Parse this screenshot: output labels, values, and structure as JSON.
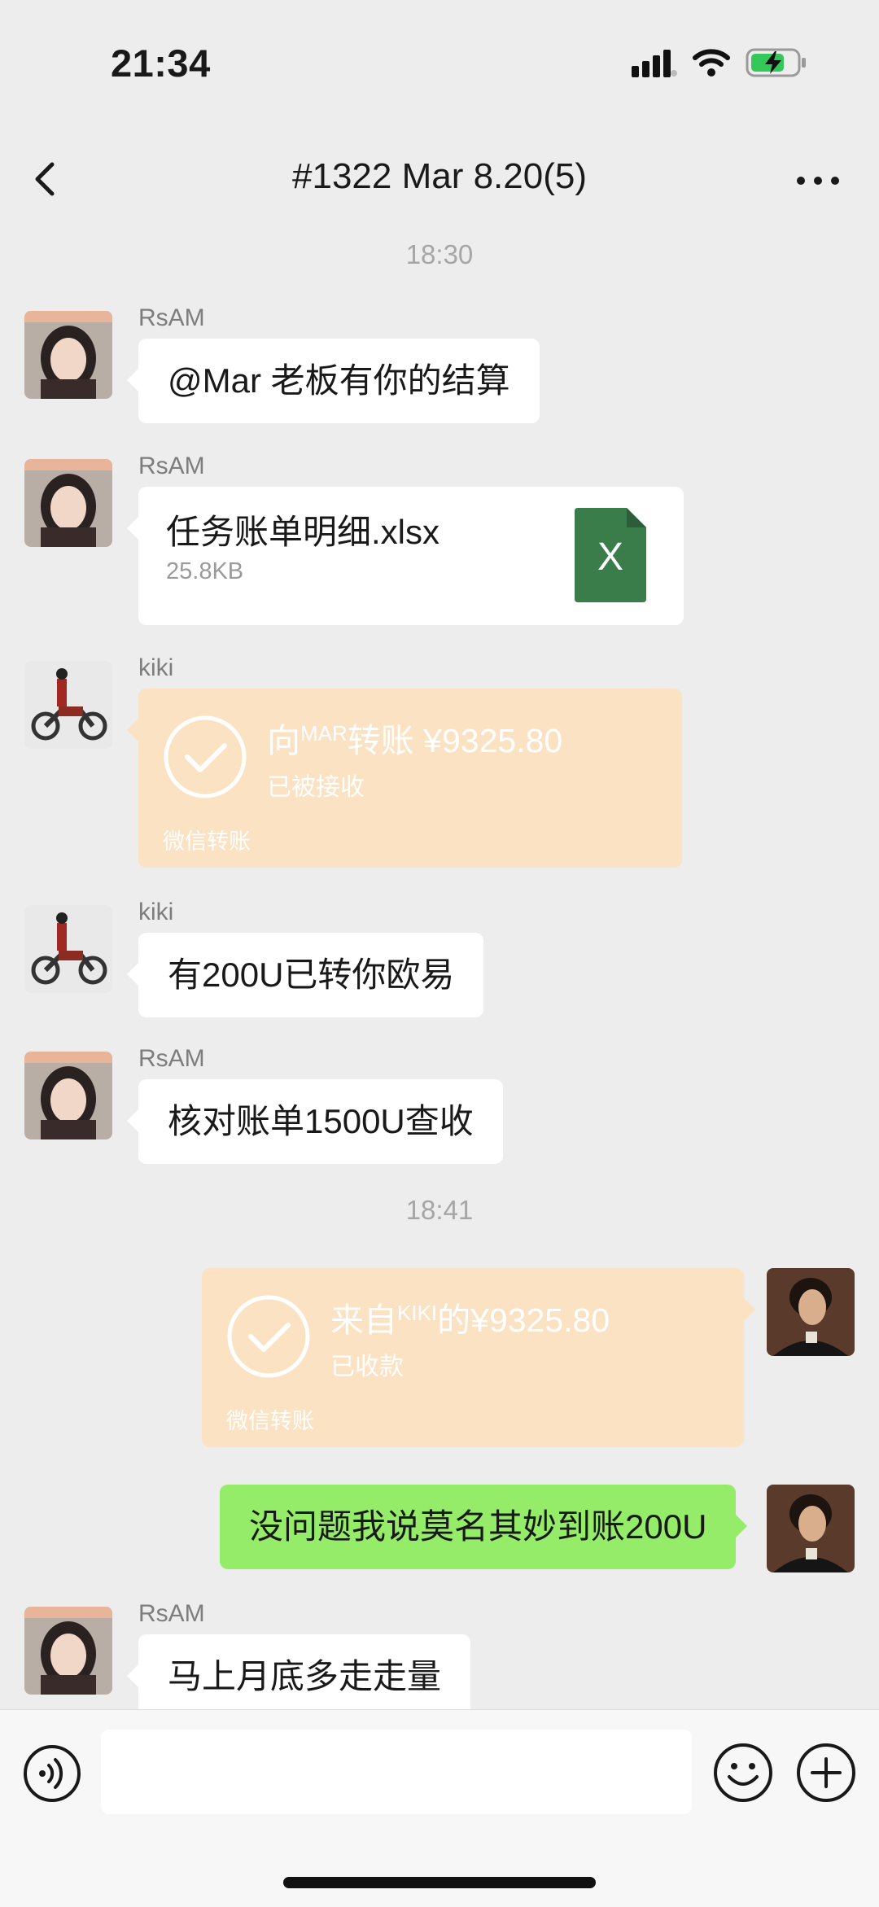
{
  "status_bar": {
    "time": "21:34",
    "battery": "charging",
    "signal_icon": "cellular-signal-icon",
    "wifi_icon": "wifi-icon"
  },
  "header": {
    "title": "#1322 Mar 8.20(5)",
    "back_icon": "chevron-left-icon",
    "more_icon": "more-dots-icon"
  },
  "messages": [
    {
      "type": "timestamp",
      "text": "18:30"
    },
    {
      "type": "text",
      "side": "left",
      "sender": "RsAM",
      "avatar": "girl-photo",
      "text": "@Mar 老板有你的结算"
    },
    {
      "type": "file",
      "side": "left",
      "sender": "RsAM",
      "avatar": "girl-photo",
      "file_name": "任务账单明细.xlsx",
      "file_size": "25.8KB",
      "file_icon_letter": "X",
      "icon_color": "#3a7d4b"
    },
    {
      "type": "transfer",
      "side": "left",
      "sender": "kiki",
      "avatar": "motorcycle-photo",
      "title_prefix": "向",
      "title_small": "MAR",
      "title_suffix": "转账 ¥9325.80",
      "status": "已被接收",
      "footer": "微信转账"
    },
    {
      "type": "text",
      "side": "left",
      "sender": "kiki",
      "avatar": "motorcycle-photo",
      "text": "有200U已转你欧易"
    },
    {
      "type": "text",
      "side": "left",
      "sender": "RsAM",
      "avatar": "girl-photo",
      "text": "核对账单1500U查收"
    },
    {
      "type": "timestamp",
      "text": "18:41"
    },
    {
      "type": "transfer",
      "side": "right",
      "avatar": "portrait-painting",
      "title_prefix": "来自",
      "title_small": "KIKI",
      "title_suffix": "的¥9325.80",
      "status": "已收款",
      "footer": "微信转账"
    },
    {
      "type": "text",
      "side": "right",
      "avatar": "portrait-painting",
      "text": "没问题我说莫名其妙到账200U"
    },
    {
      "type": "text",
      "side": "left",
      "sender": "RsAM",
      "avatar": "girl-photo",
      "text": "马上月底多走走量"
    }
  ],
  "input_bar": {
    "voice_icon": "voice-icon",
    "input_value": "",
    "emoji_icon": "emoji-icon",
    "plus_icon": "plus-icon"
  },
  "colors": {
    "background": "#ededed",
    "bubble_self": "#95ec69",
    "bubble_other": "#ffffff",
    "transfer": "#fbe2c3",
    "excel": "#3a7d4b"
  }
}
